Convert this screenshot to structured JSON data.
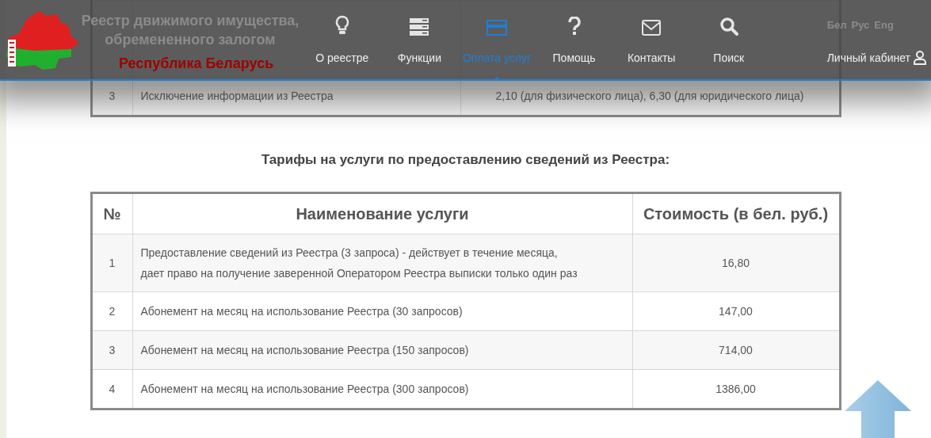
{
  "header": {
    "title_lines": [
      "Реестр движимого имущества,",
      "обремененного залогом"
    ],
    "subtitle": "Республика Беларусь",
    "nav": [
      {
        "label": "О реестре",
        "kind": "lightbulb",
        "selected": false
      },
      {
        "label": "Функции",
        "kind": "server",
        "selected": false
      },
      {
        "label": "Оплата услуг",
        "kind": "card",
        "selected": true
      },
      {
        "label": "Помощь",
        "kind": "question",
        "selected": false
      },
      {
        "label": "Контакты",
        "kind": "envelope",
        "selected": false
      },
      {
        "label": "Поиск",
        "kind": "search",
        "selected": false
      }
    ],
    "languages": [
      "Бел",
      "Рус",
      "Eng"
    ],
    "account": "Личный кабинет"
  },
  "table_1": {
    "rows": [
      {
        "number": "3",
        "service": "Исключение информации из Реестра",
        "cost": "2,10 (для физического лица), 6,30 (для юридического лица)"
      }
    ]
  },
  "section_title": "Тарифы на услуги по предоставлению сведений из Реестра:",
  "table_2": {
    "columns": [
      "№",
      "Наименование услуги",
      "Стоимость (в бел. руб.)"
    ],
    "rows": [
      {
        "number": "1",
        "service_lines": [
          "Предоставление сведений из Реестра (3 запроса) - действует в течение месяца,",
          "дает право на получение заверенной Оператором Реестра выписки только один раз"
        ],
        "cost": "16,80"
      },
      {
        "number": "2",
        "service_lines": [
          "Абонемент на месяц на использование Реестра (30 запросов)"
        ],
        "cost": "147,00"
      },
      {
        "number": "3",
        "service_lines": [
          "Абонемент на месяц на использование Реестра (150 запросов)"
        ],
        "cost": "714,00"
      },
      {
        "number": "4",
        "service_lines": [
          "Абонемент на месяц на использование Реестра (300 запросов)"
        ],
        "cost": "1386,00"
      }
    ]
  }
}
